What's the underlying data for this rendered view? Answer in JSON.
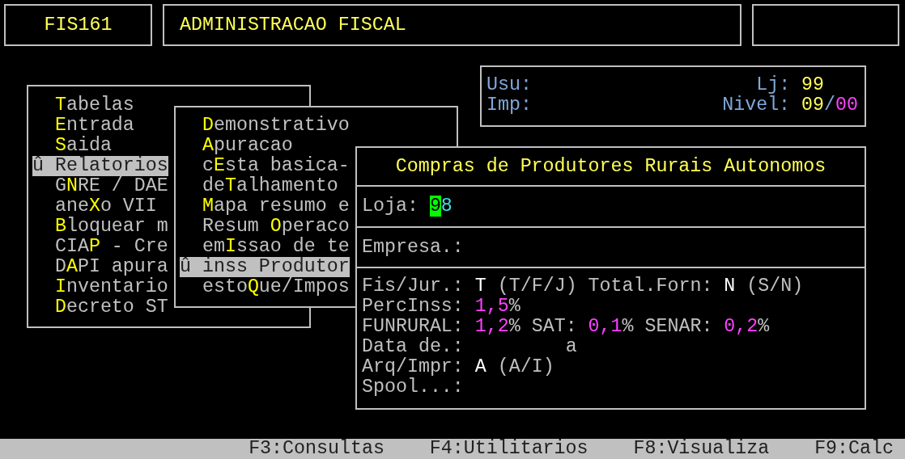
{
  "header": {
    "program": "FIS161",
    "title": "ADMINISTRACAO FISCAL"
  },
  "session": {
    "user_label": "Usu:",
    "printer_label": "Imp:",
    "store_label": "Lj:",
    "store": "99",
    "level_label": "Nivel:",
    "level_major": "09",
    "level_sep": "/",
    "level_minor": "00"
  },
  "main_menu": [
    {
      "key": "T",
      "rest": "abelas",
      "selected": false
    },
    {
      "key": "E",
      "rest": "ntrada",
      "selected": false
    },
    {
      "key": "S",
      "rest": "aida",
      "selected": false
    },
    {
      "lead": "û ",
      "key": "R",
      "rest": "elatorios",
      "selected": true
    },
    {
      "lead": "G",
      "key": "N",
      "rest": "RE / DAE",
      "selected": false
    },
    {
      "lead": "ane",
      "key": "X",
      "rest": "o VII",
      "selected": false
    },
    {
      "key": "B",
      "rest": "loquear m",
      "selected": false
    },
    {
      "lead": "CIA",
      "key": "P",
      "rest": " - Cre",
      "selected": false
    },
    {
      "lead": "D",
      "key": "A",
      "rest": "PI apura",
      "selected": false
    },
    {
      "key": "I",
      "rest": "nventario",
      "selected": false
    },
    {
      "key": "D",
      "rest": "ecreto ST",
      "selected": false
    }
  ],
  "sub_menu": [
    {
      "key": "D",
      "rest": "emonstrativo",
      "selected": false
    },
    {
      "key": "A",
      "rest": "puracao",
      "selected": false
    },
    {
      "lead": "c",
      "key": "E",
      "rest": "sta basica-",
      "selected": false
    },
    {
      "lead": "de",
      "key": "T",
      "rest": "alhamento",
      "selected": false
    },
    {
      "key": "M",
      "rest": "apa resumo e",
      "selected": false
    },
    {
      "lead": "Resum ",
      "key": "O",
      "rest": "peraco",
      "selected": false
    },
    {
      "lead": "em",
      "key": "I",
      "rest": "ssao de te",
      "selected": false
    },
    {
      "lead": "û ",
      "key": "i",
      "rest": "nss Produtor",
      "selected": true
    },
    {
      "lead": "esto",
      "key": "Q",
      "rest": "ue/Impos",
      "selected": false
    }
  ],
  "dialog": {
    "title": "Compras de Produtores Rurais Autonomos",
    "store_field": {
      "label": "Loja:",
      "value": "98",
      "cursor": true
    },
    "company_field": {
      "label": "Empresa.:"
    },
    "lines": [
      {
        "items": [
          {
            "kind": "label",
            "text": "Fis/Jur.:"
          },
          {
            "kind": "value",
            "text": "T"
          },
          {
            "kind": "hint",
            "text": "(T/F/J)"
          },
          {
            "kind": "label",
            "text": "Total.Forn:"
          },
          {
            "kind": "value",
            "text": "N"
          },
          {
            "kind": "hint",
            "text": "(S/N)"
          }
        ]
      },
      {
        "items": [
          {
            "kind": "label",
            "text": "PercInss:"
          },
          {
            "kind": "number",
            "text": "1,5",
            "unit": "%"
          }
        ]
      },
      {
        "items": [
          {
            "kind": "label",
            "text": "FUNRURAL:"
          },
          {
            "kind": "number",
            "text": "1,2",
            "unit": "%"
          },
          {
            "kind": "label",
            "text": "SAT:"
          },
          {
            "kind": "number",
            "text": "0,1",
            "unit": "%"
          },
          {
            "kind": "label",
            "text": "SENAR:"
          },
          {
            "kind": "number",
            "text": "0,2",
            "unit": "%"
          }
        ]
      },
      {
        "items": [
          {
            "kind": "label",
            "text": "Data de.:"
          },
          {
            "kind": "range",
            "text": "a"
          }
        ]
      },
      {
        "items": [
          {
            "kind": "label",
            "text": "Arq/Impr:"
          },
          {
            "kind": "value",
            "text": "A"
          },
          {
            "kind": "hint",
            "text": "(A/I)"
          }
        ]
      },
      {
        "items": [
          {
            "kind": "label",
            "text": "Spool...:"
          }
        ]
      }
    ]
  },
  "status_bar": [
    "F3:Consultas",
    "F4:Utilitarios",
    "F8:Visualiza",
    "F9:Calc"
  ]
}
